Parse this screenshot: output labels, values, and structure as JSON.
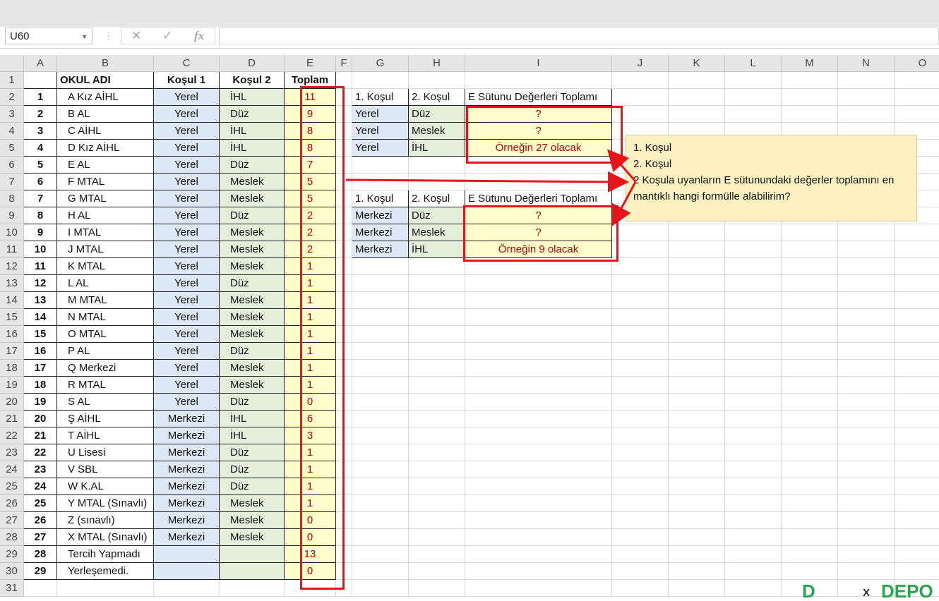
{
  "formula_bar": {
    "name_box": "U60",
    "cancel_icon": "✕",
    "enter_icon": "✓",
    "fx_label": "fx",
    "formula": ""
  },
  "columns": [
    "A",
    "B",
    "C",
    "D",
    "E",
    "F",
    "G",
    "H",
    "I",
    "J",
    "K",
    "L",
    "M",
    "N",
    "O"
  ],
  "rows": [
    "1",
    "2",
    "3",
    "4",
    "5",
    "6",
    "7",
    "8",
    "9",
    "10",
    "11",
    "12",
    "13",
    "14",
    "15",
    "16",
    "17",
    "18",
    "19",
    "20",
    "21",
    "22",
    "23",
    "24",
    "25",
    "26",
    "27",
    "28",
    "29",
    "30",
    "31"
  ],
  "header_row": {
    "a": "",
    "b": "OKUL ADI",
    "c": "Koşul 1",
    "d": "Koşul 2",
    "e": "Toplam"
  },
  "main_table": [
    {
      "a": "1",
      "b": "A Kız AİHL",
      "c": "Yerel",
      "d": "İHL",
      "e": "11"
    },
    {
      "a": "2",
      "b": "B AL",
      "c": "Yerel",
      "d": "Düz",
      "e": "9"
    },
    {
      "a": "3",
      "b": "C AİHL",
      "c": "Yerel",
      "d": "İHL",
      "e": "8"
    },
    {
      "a": "4",
      "b": "D Kız AİHL",
      "c": "Yerel",
      "d": "İHL",
      "e": "8"
    },
    {
      "a": "5",
      "b": "E AL",
      "c": "Yerel",
      "d": "Düz",
      "e": "7"
    },
    {
      "a": "6",
      "b": "F MTAL",
      "c": "Yerel",
      "d": "Meslek",
      "e": "5"
    },
    {
      "a": "7",
      "b": "G MTAL",
      "c": "Yerel",
      "d": "Meslek",
      "e": "5"
    },
    {
      "a": "8",
      "b": "H AL",
      "c": "Yerel",
      "d": "Düz",
      "e": "2"
    },
    {
      "a": "9",
      "b": "I MTAL",
      "c": "Yerel",
      "d": "Meslek",
      "e": "2"
    },
    {
      "a": "10",
      "b": "J MTAL",
      "c": "Yerel",
      "d": "Meslek",
      "e": "2"
    },
    {
      "a": "11",
      "b": "K MTAL",
      "c": "Yerel",
      "d": "Meslek",
      "e": "1"
    },
    {
      "a": "12",
      "b": "L AL",
      "c": "Yerel",
      "d": "Düz",
      "e": "1"
    },
    {
      "a": "13",
      "b": "M MTAL",
      "c": "Yerel",
      "d": "Meslek",
      "e": "1"
    },
    {
      "a": "14",
      "b": "N MTAL",
      "c": "Yerel",
      "d": "Meslek",
      "e": "1"
    },
    {
      "a": "15",
      "b": "O MTAL",
      "c": "Yerel",
      "d": "Meslek",
      "e": "1"
    },
    {
      "a": "16",
      "b": "P AL",
      "c": "Yerel",
      "d": "Düz",
      "e": "1"
    },
    {
      "a": "17",
      "b": "Q Merkezi",
      "c": "Yerel",
      "d": "Meslek",
      "e": "1"
    },
    {
      "a": "18",
      "b": "R MTAL",
      "c": "Yerel",
      "d": "Meslek",
      "e": "1"
    },
    {
      "a": "19",
      "b": "S AL",
      "c": "Yerel",
      "d": "Düz",
      "e": "0"
    },
    {
      "a": "20",
      "b": "Ş AİHL",
      "c": "Merkezi",
      "d": "İHL",
      "e": "6"
    },
    {
      "a": "21",
      "b": "T AİHL",
      "c": "Merkezi",
      "d": "İHL",
      "e": "3"
    },
    {
      "a": "22",
      "b": "U Lisesi",
      "c": "Merkezi",
      "d": "Düz",
      "e": "1"
    },
    {
      "a": "23",
      "b": "V SBL",
      "c": "Merkezi",
      "d": "Düz",
      "e": "1"
    },
    {
      "a": "24",
      "b": "W K.AL",
      "c": "Merkezi",
      "d": "Düz",
      "e": "1"
    },
    {
      "a": "25",
      "b": "Y MTAL (Sınavlı)",
      "c": "Merkezi",
      "d": "Meslek",
      "e": "1"
    },
    {
      "a": "26",
      "b": "Z (sınavlı)",
      "c": "Merkezi",
      "d": "Meslek",
      "e": "0"
    },
    {
      "a": "27",
      "b": "X MTAL (Sınavlı)",
      "c": "Merkezi",
      "d": "Meslek",
      "e": "0"
    },
    {
      "a": "28",
      "b": "Tercih Yapmadı",
      "c": "",
      "d": "",
      "e": "13"
    },
    {
      "a": "29",
      "b": "Yerleşemedi.",
      "c": "",
      "d": "",
      "e": "0"
    }
  ],
  "summary_tables": [
    {
      "header": {
        "g": "1. Koşul",
        "h": "2. Koşul",
        "i": "E Sütunu Değerleri Toplamı"
      },
      "rows": [
        {
          "g": "Yerel",
          "h": "Düz",
          "i": "?"
        },
        {
          "g": "Yerel",
          "h": "Meslek",
          "i": "?"
        },
        {
          "g": "Yerel",
          "h": "İHL",
          "i": "Örneğin 27 olacak"
        }
      ]
    },
    {
      "header": {
        "g": "1. Koşul",
        "h": "2. Koşul",
        "i": "E Sütunu Değerleri Toplamı"
      },
      "rows": [
        {
          "g": "Merkezi",
          "h": "Düz",
          "i": "?"
        },
        {
          "g": "Merkezi",
          "h": "Meslek",
          "i": "?"
        },
        {
          "g": "Merkezi",
          "h": "İHL",
          "i": "Örneğin 9 olacak"
        }
      ]
    }
  ],
  "note": {
    "line1": "1. Koşul",
    "line2": "2. Koşul",
    "line3": "2 Koşula uyanların E sütunundaki değerler toplamını en mantıklı hangi formülle alabilirim?"
  },
  "colors": {
    "accent_red": "#e8141c",
    "value_red": "#c00000",
    "blue_fill": "#dde9f6",
    "green_fill": "#e3efda",
    "yellow_fill": "#fffdcc"
  }
}
